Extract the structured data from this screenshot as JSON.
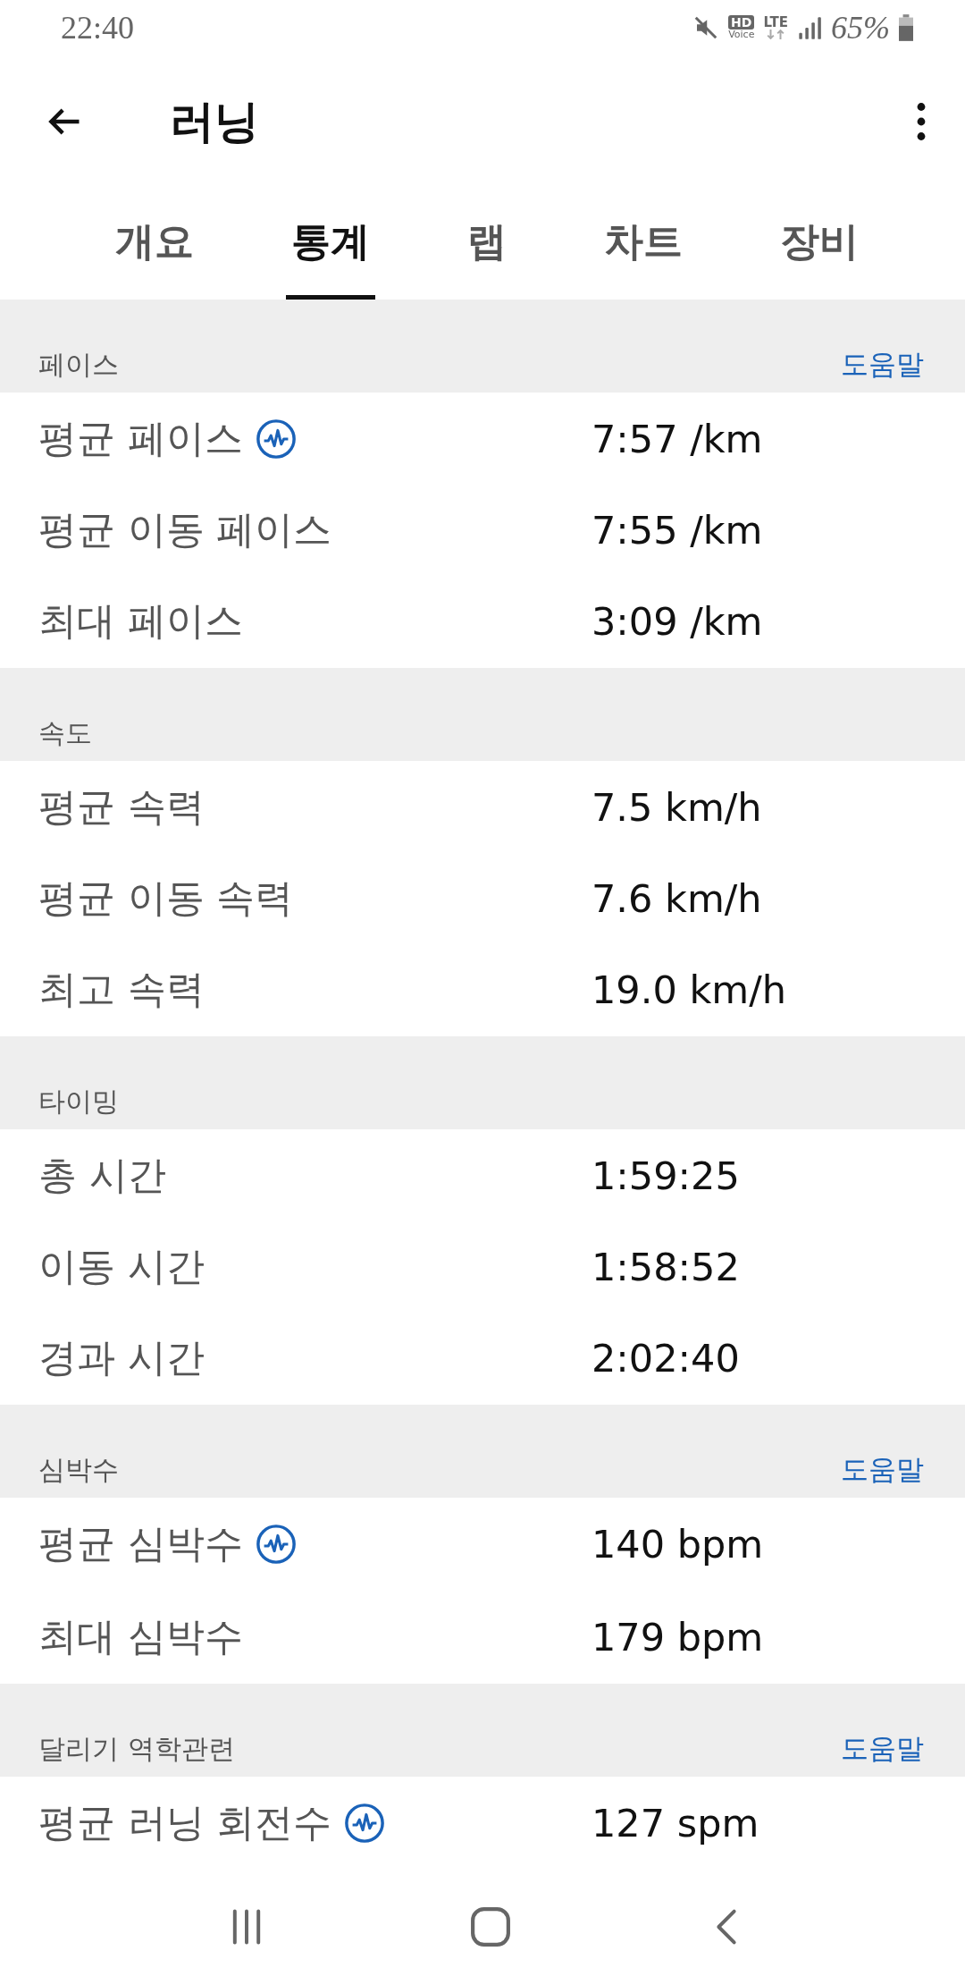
{
  "status_bar": {
    "time": "22:40",
    "hd": "HD",
    "voice": "Voice",
    "network": "LTE",
    "battery": "65%"
  },
  "app_bar": {
    "title": "러닝"
  },
  "tabs": [
    {
      "label": "개요",
      "selected": false
    },
    {
      "label": "통계",
      "selected": true
    },
    {
      "label": "랩",
      "selected": false
    },
    {
      "label": "차트",
      "selected": false
    },
    {
      "label": "장비",
      "selected": false
    }
  ],
  "sections": [
    {
      "title": "페이스",
      "help": "도움말",
      "rows": [
        {
          "label": "평균 페이스",
          "value": "7:57 /km",
          "insight": true
        },
        {
          "label": "평균 이동 페이스",
          "value": "7:55 /km"
        },
        {
          "label": "최대 페이스",
          "value": "3:09 /km"
        }
      ]
    },
    {
      "title": "속도",
      "rows": [
        {
          "label": "평균 속력",
          "value": "7.5 km/h"
        },
        {
          "label": "평균 이동 속력",
          "value": "7.6 km/h"
        },
        {
          "label": "최고 속력",
          "value": "19.0 km/h"
        }
      ]
    },
    {
      "title": "타이밍",
      "rows": [
        {
          "label": "총 시간",
          "value": "1:59:25"
        },
        {
          "label": "이동 시간",
          "value": "1:58:52"
        },
        {
          "label": "경과 시간",
          "value": "2:02:40"
        }
      ]
    },
    {
      "title": "심박수",
      "help": "도움말",
      "rows": [
        {
          "label": "평균 심박수",
          "value": "140 bpm",
          "insight": true
        },
        {
          "label": "최대 심박수",
          "value": "179 bpm"
        }
      ]
    },
    {
      "title": "달리기 역학관련",
      "help": "도움말",
      "rows": [
        {
          "label": "평균 러닝 회전수",
          "value": "127 spm",
          "insight": true
        }
      ]
    }
  ]
}
